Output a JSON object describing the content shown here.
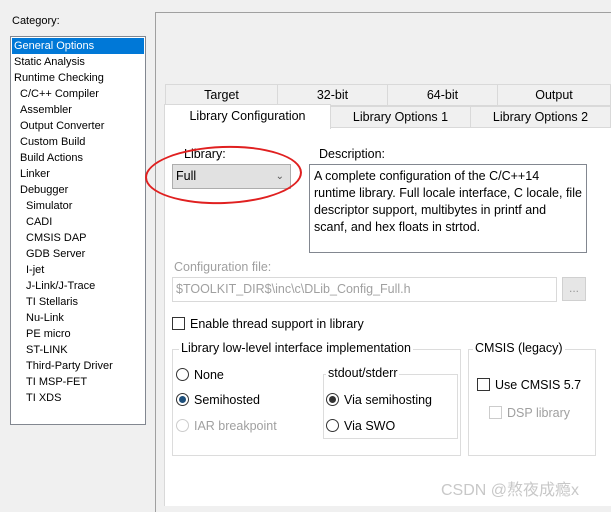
{
  "category": {
    "label": "Category:",
    "items": [
      {
        "label": "General Options",
        "level": 0,
        "selected": true
      },
      {
        "label": "Static Analysis",
        "level": 0
      },
      {
        "label": "Runtime Checking",
        "level": 0
      },
      {
        "label": "C/C++ Compiler",
        "level": 1
      },
      {
        "label": "Assembler",
        "level": 1
      },
      {
        "label": "Output Converter",
        "level": 1
      },
      {
        "label": "Custom Build",
        "level": 1
      },
      {
        "label": "Build Actions",
        "level": 1
      },
      {
        "label": "Linker",
        "level": 1
      },
      {
        "label": "Debugger",
        "level": 1
      },
      {
        "label": "Simulator",
        "level": 2
      },
      {
        "label": "CADI",
        "level": 2
      },
      {
        "label": "CMSIS DAP",
        "level": 2
      },
      {
        "label": "GDB Server",
        "level": 2
      },
      {
        "label": "I-jet",
        "level": 2
      },
      {
        "label": "J-Link/J-Trace",
        "level": 2
      },
      {
        "label": "TI Stellaris",
        "level": 2
      },
      {
        "label": "Nu-Link",
        "level": 2
      },
      {
        "label": "PE micro",
        "level": 2
      },
      {
        "label": "ST-LINK",
        "level": 2
      },
      {
        "label": "Third-Party Driver",
        "level": 2
      },
      {
        "label": "TI MSP-FET",
        "level": 2
      },
      {
        "label": "TI XDS",
        "level": 2
      }
    ]
  },
  "tabs": {
    "row1": [
      "Target",
      "32-bit",
      "64-bit",
      "Output"
    ],
    "row2": [
      "Library Configuration",
      "Library Options 1",
      "Library Options 2"
    ],
    "active": "Library Configuration"
  },
  "library": {
    "label": "Library:",
    "value": "Full"
  },
  "description": {
    "label": "Description:",
    "text": "A complete configuration of the C/C++14 runtime library. Full locale interface, C locale, file descriptor support, multibytes in printf and scanf, and hex floats in strtod."
  },
  "config_file": {
    "label": "Configuration file:",
    "value": "$TOOLKIT_DIR$\\inc\\c\\DLib_Config_Full.h",
    "browse": "..."
  },
  "thread_support": {
    "label": "Enable thread support in library",
    "checked": false
  },
  "lowlevel": {
    "title": "Library low-level interface implementation",
    "options": [
      "None",
      "Semihosted",
      "IAR breakpoint"
    ],
    "selected": "Semihosted"
  },
  "stdout": {
    "title": "stdout/stderr",
    "options": [
      "Via semihosting",
      "Via SWO"
    ],
    "selected": "Via semihosting"
  },
  "cmsis": {
    "title": "CMSIS (legacy)",
    "use_label": "Use CMSIS 5.7",
    "dsp_label": "DSP library"
  },
  "watermark": "CSDN @熬夜成瘾x",
  "colors": {
    "selection": "#0078d7",
    "highlight_ellipse": "#e02020"
  }
}
